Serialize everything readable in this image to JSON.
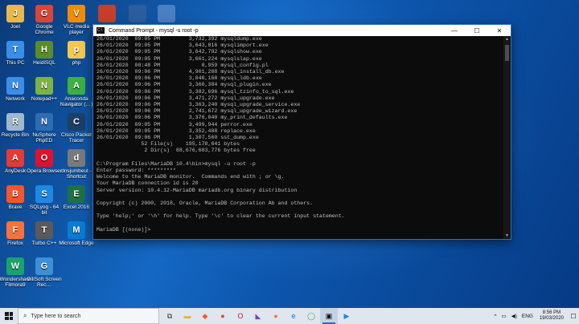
{
  "desktop": {
    "icons": [
      {
        "label": "Joel",
        "icon": "user-folder-icon",
        "color": "#e8b84a"
      },
      {
        "label": "Google Chrome",
        "icon": "chrome-icon",
        "color": "#db4437"
      },
      {
        "label": "VLC media player",
        "icon": "vlc-icon",
        "color": "#f08c00"
      },
      {
        "label": "",
        "icon": "powerpoint-icon",
        "color": "#c4402a"
      },
      {
        "label": "",
        "icon": "seaborn-app-icon",
        "color": "#2c5d9e"
      },
      {
        "label": "",
        "icon": "network-app-icon",
        "color": "#4a7fc1"
      },
      {
        "label": "This PC",
        "icon": "this-pc-icon",
        "color": "#3a8ee6"
      },
      {
        "label": "HeidiSQL",
        "icon": "heidisql-icon",
        "color": "#5a8c2a"
      },
      {
        "label": "php",
        "icon": "folder-icon",
        "color": "#f2c94c"
      },
      {
        "label": "Network",
        "icon": "network-icon",
        "color": "#3a8ee6"
      },
      {
        "label": "Notepad++",
        "icon": "notepadpp-icon",
        "color": "#7cb342"
      },
      {
        "label": "Anaconda Navigator (…)",
        "icon": "anaconda-icon",
        "color": "#3cb043"
      },
      {
        "label": "Recycle Bin",
        "icon": "recycle-bin-icon",
        "color": "#9fb8d0"
      },
      {
        "label": "NuSphere PhpED",
        "icon": "phped-icon",
        "color": "#2d6cb3"
      },
      {
        "label": "Cisco Packet Tracer",
        "icon": "packet-tracer-icon",
        "color": "#1c3f66"
      },
      {
        "label": "AnyDesk",
        "icon": "anydesk-icon",
        "color": "#e53935"
      },
      {
        "label": "Opera Browser",
        "icon": "opera-icon",
        "color": "#e0102e"
      },
      {
        "label": "dnsjumbeut - Shortcut",
        "icon": "shortcut-icon",
        "color": "#7a7a7a"
      },
      {
        "label": "Brave",
        "icon": "brave-icon",
        "color": "#fb542b"
      },
      {
        "label": "SQLyog - 64 bit",
        "icon": "sqlyog-icon",
        "color": "#1e88e5"
      },
      {
        "label": "Excel 2016",
        "icon": "excel-icon",
        "color": "#1e7145"
      },
      {
        "label": "Firefox",
        "icon": "firefox-icon",
        "color": "#ff7139"
      },
      {
        "label": "Turbo C++",
        "icon": "turbo-cpp-icon",
        "color": "#5a5a5a"
      },
      {
        "label": "Microsoft Edge",
        "icon": "edge-icon",
        "color": "#0a7bd4"
      },
      {
        "label": "Wondershare Filmora9",
        "icon": "filmora-icon",
        "color": "#1aa36a"
      },
      {
        "label": "GiliSoft Screen Rec…",
        "icon": "screen-recorder-icon",
        "color": "#3d8fd6"
      }
    ]
  },
  "cmd": {
    "title": "Command Prompt - mysql  -u root -p",
    "minimize": "—",
    "maximize": "☐",
    "close": "✕",
    "lines": [
      "26/01/2020  09:05 PM         3,732,392 mysqldump.exe",
      "26/01/2020  09:05 PM         3,643,816 mysqlimport.exe",
      "26/01/2020  09:05 PM         3,642,792 mysqlshow.exe",
      "26/01/2020  09:05 PM         3,661,224 mysqlslap.exe",
      "26/01/2020  08:48 PM             8,959 mysql_config.pl",
      "26/01/2020  09:06 PM         4,901,288 mysql_install_db.exe",
      "26/01/2020  09:06 PM         3,040,168 mysql_ldb.exe",
      "26/01/2020  09:06 PM         3,360,384 mysql_plugin.exe",
      "26/01/2020  09:06 PM         3,382,696 mysql_tzinfo_to_sql.exe",
      "26/01/2020  09:06 PM         3,471,272 mysql_upgrade.exe",
      "26/01/2020  09:06 PM         3,363,240 mysql_upgrade_service.exe",
      "26/01/2020  09:06 PM         2,741,672 mysql_upgrade_wizard.exe",
      "26/01/2020  09:06 PM         3,376,040 my_print_defaults.exe",
      "26/01/2020  09:05 PM         3,499,944 perror.exe",
      "26/01/2020  09:05 PM         3,352,488 replace.exe",
      "26/01/2020  09:06 PM         1,307,560 sst_dump.exe",
      "              52 File(s)    195,178,641 bytes",
      "               2 Dir(s)  88,676,683,776 bytes free",
      "",
      "C:\\Program Files\\MariaDB 10.4\\bin>mysql -u root -p",
      "Enter password: *********",
      "Welcome to the MariaDB monitor.  Commands end with ; or \\g.",
      "Your MariaDB connection id is 20",
      "Server version: 10.4.12-MariaDB mariadb.org binary distribution",
      "",
      "Copyright (c) 2000, 2018, Oracle, MariaDB Corporation Ab and others.",
      "",
      "Type 'help;' or '\\h' for help. Type '\\c' to clear the current input statement.",
      "",
      "MariaDB [(none)]>"
    ]
  },
  "taskbar": {
    "search_placeholder": "Type here to search",
    "apps": [
      {
        "icon": "task-view-icon",
        "glyph": "⧉",
        "color": "#333"
      },
      {
        "icon": "file-explorer-icon",
        "glyph": "▬",
        "color": "#e2b13c"
      },
      {
        "icon": "brave-icon",
        "glyph": "◆",
        "color": "#fb542b"
      },
      {
        "icon": "chrome-icon",
        "glyph": "●",
        "color": "#db4437"
      },
      {
        "icon": "opera-icon",
        "glyph": "O",
        "color": "#e0102e"
      },
      {
        "icon": "visual-studio-icon",
        "glyph": "◣",
        "color": "#7b3fb8"
      },
      {
        "icon": "firefox-icon",
        "glyph": "●",
        "color": "#ff7139"
      },
      {
        "icon": "edge-icon",
        "glyph": "e",
        "color": "#0a7bd4"
      },
      {
        "icon": "anaconda-icon",
        "glyph": "◯",
        "color": "#3cb043"
      },
      {
        "icon": "command-prompt-icon",
        "glyph": "▣",
        "color": "#111"
      },
      {
        "icon": "media-player-icon",
        "glyph": "▶",
        "color": "#1e88e5"
      }
    ],
    "active_index": 9,
    "tray": {
      "chevron": "^",
      "language": "ENG",
      "time": "8:56 PM",
      "date": "19/03/2020",
      "notification": "☐"
    }
  }
}
